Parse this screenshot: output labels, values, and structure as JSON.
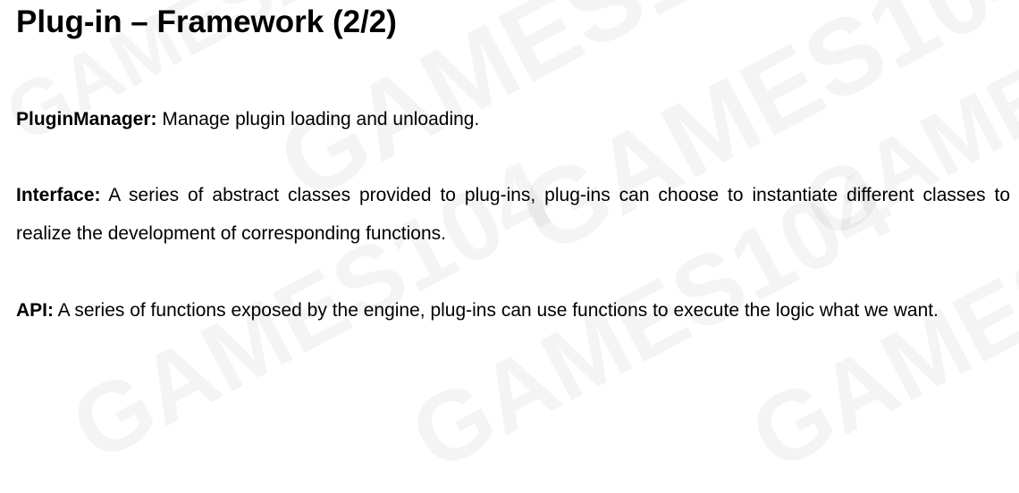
{
  "slide": {
    "title": "Plug-in – Framework (2/2)",
    "watermark": "GAMES104"
  },
  "items": [
    {
      "term": "PluginManager:",
      "description": " Manage plugin loading and unloading."
    },
    {
      "term": "Interface:",
      "description": " A series of abstract classes provided to plug-ins, plug-ins can choose to instantiate different classes to realize the development of corresponding functions."
    },
    {
      "term": "API:",
      "description": " A series of functions exposed by the engine, plug-ins can use functions to execute the logic what we want."
    }
  ]
}
